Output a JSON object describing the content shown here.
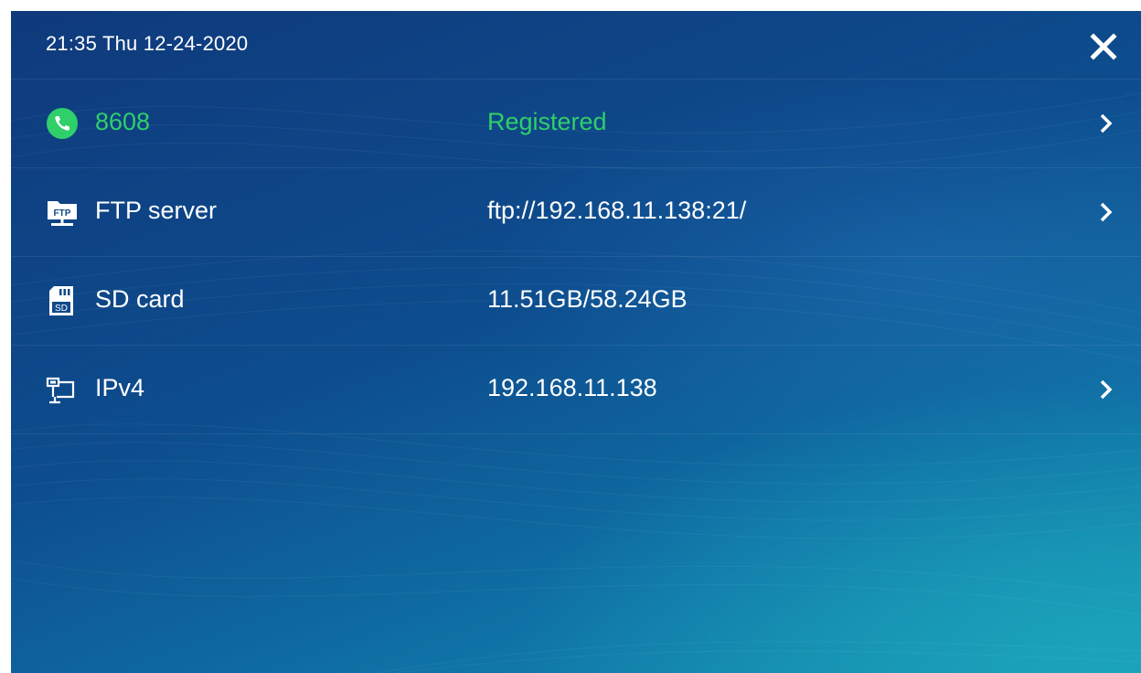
{
  "header": {
    "datetime": "21:35 Thu  12-24-2020",
    "close_icon": "close-icon"
  },
  "colors": {
    "registered_green": "#2fcf6a",
    "background_top": "#0f3a7c",
    "background_bottom": "#1595b2"
  },
  "rows": [
    {
      "icon": "phone-icon",
      "label": "8608",
      "value": "Registered",
      "has_chevron": true
    },
    {
      "icon": "ftp-folder-icon",
      "label": "FTP server",
      "value": "ftp://192.168.11.138:21/",
      "has_chevron": true
    },
    {
      "icon": "sd-card-icon",
      "label": "SD card",
      "value": "11.51GB/58.24GB",
      "has_chevron": false
    },
    {
      "icon": "network-icon",
      "label": "IPv4",
      "value": "192.168.11.138",
      "has_chevron": true
    }
  ],
  "icon_text": {
    "ftp": "FTP",
    "sd": "SD"
  }
}
